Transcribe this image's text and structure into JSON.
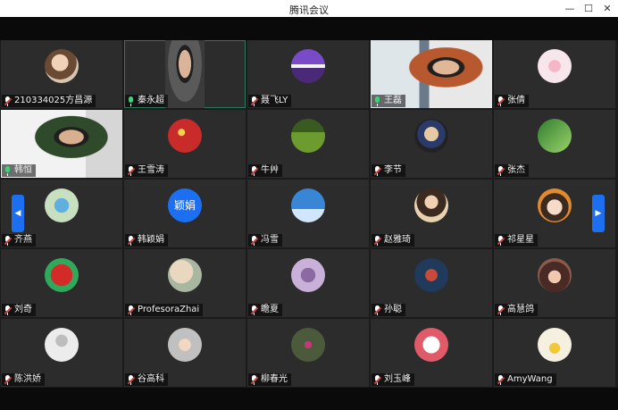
{
  "window": {
    "title": "腾讯会议",
    "min_icon": "minimize-icon",
    "max_icon": "maximize-icon",
    "close_icon": "close-icon"
  },
  "colors": {
    "accent": "#1d6ff2",
    "active_border": "#2f7a5c",
    "mute": "#e03a3a",
    "unmuted": "#3fd17a"
  },
  "participants": [
    {
      "name": "210334025方昌源",
      "muted": true,
      "avatar": "girl-photo"
    },
    {
      "name": "秦永超",
      "muted": false,
      "video": true,
      "active": true
    },
    {
      "name": "聂飞LY",
      "muted": true,
      "avatar": "cartoon-pair"
    },
    {
      "name": "王磊",
      "muted": false,
      "video": true
    },
    {
      "name": "张倩",
      "muted": true,
      "avatar": "flower-pink"
    },
    {
      "name": "韩恒",
      "muted": false,
      "video": true
    },
    {
      "name": "王雪涛",
      "muted": true,
      "avatar": "red-flag"
    },
    {
      "name": "牛艸",
      "muted": true,
      "avatar": "grassland"
    },
    {
      "name": "李节",
      "muted": true,
      "avatar": "portrait-painting"
    },
    {
      "name": "张杰",
      "muted": true,
      "avatar": "green-leaf"
    },
    {
      "name": "齐燕",
      "muted": true,
      "avatar": "child-photo"
    },
    {
      "name": "韩颖娟",
      "muted": true,
      "avatar_text": "颖娟"
    },
    {
      "name": "冯雪",
      "muted": true,
      "avatar": "blue-sky"
    },
    {
      "name": "赵雅琦",
      "muted": true,
      "avatar": "woman-photo"
    },
    {
      "name": "祁星星",
      "muted": true,
      "avatar": "cartoon-girl"
    },
    {
      "name": "刘奇",
      "muted": true,
      "avatar": "red-paper-cut"
    },
    {
      "name": "ProfesoraZhai",
      "muted": true,
      "avatar": "ink-painting"
    },
    {
      "name": "瞻夏",
      "muted": true,
      "avatar": "purple-photo"
    },
    {
      "name": "孙聪",
      "muted": true,
      "avatar": "dark-photo"
    },
    {
      "name": "高慧鸽",
      "muted": true,
      "avatar": "cartoon-dark-hair"
    },
    {
      "name": "陈洪娇",
      "muted": true,
      "avatar": "default-user"
    },
    {
      "name": "谷高科",
      "muted": true,
      "avatar": "kid-photo"
    },
    {
      "name": "柳春光",
      "muted": true,
      "avatar": "tree-photo"
    },
    {
      "name": "刘玉峰",
      "muted": true,
      "avatar": "puppy-photo"
    },
    {
      "name": "AmyWang",
      "muted": true,
      "avatar": "yellow-flower"
    }
  ],
  "nav": {
    "prev_icon": "chevron-left-icon",
    "next_icon": "chevron-right-icon"
  }
}
